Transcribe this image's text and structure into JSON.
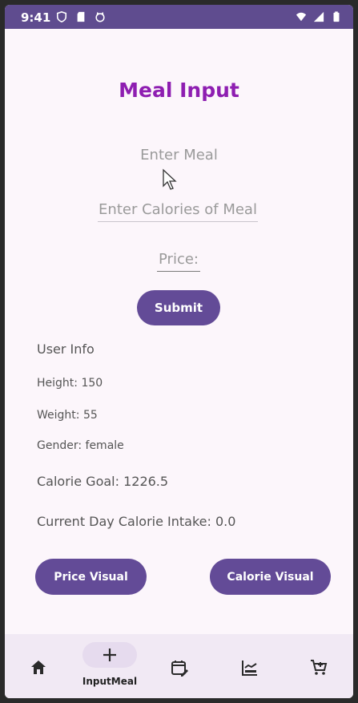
{
  "status_bar": {
    "time": "9:41",
    "left_icons": [
      "shield-icon",
      "sd-card-icon",
      "cat-face-icon"
    ],
    "right_icons": [
      "wifi-icon",
      "signal-icon",
      "battery-icon"
    ]
  },
  "page": {
    "title": "Meal Input"
  },
  "form": {
    "meal_placeholder": "Enter Meal",
    "calories_placeholder": "Enter Calories of Meal",
    "price_placeholder": "Price:",
    "submit_label": "Submit"
  },
  "user_info": {
    "heading": "User Info",
    "height": "Height: 150",
    "weight": "Weight: 55",
    "gender": "Gender: female",
    "calorie_goal": "Calorie Goal: 1226.5",
    "current_intake": "Current Day Calorie Intake: 0.0"
  },
  "actions": {
    "price_visual_label": "Price Visual",
    "calorie_visual_label": "Calorie Visual"
  },
  "bottom_nav": {
    "items": [
      {
        "icon": "home-icon"
      },
      {
        "icon": "plus-icon",
        "label": "InputMeal",
        "selected": true
      },
      {
        "icon": "calendar-edit-icon"
      },
      {
        "icon": "chart-icon"
      },
      {
        "icon": "cart-icon"
      }
    ]
  },
  "colors": {
    "accent": "#634b97",
    "title": "#8e1eb1",
    "status_bar": "#5f4c8f",
    "background": "#fcf6fb",
    "nav_background": "#f1e9f4"
  }
}
